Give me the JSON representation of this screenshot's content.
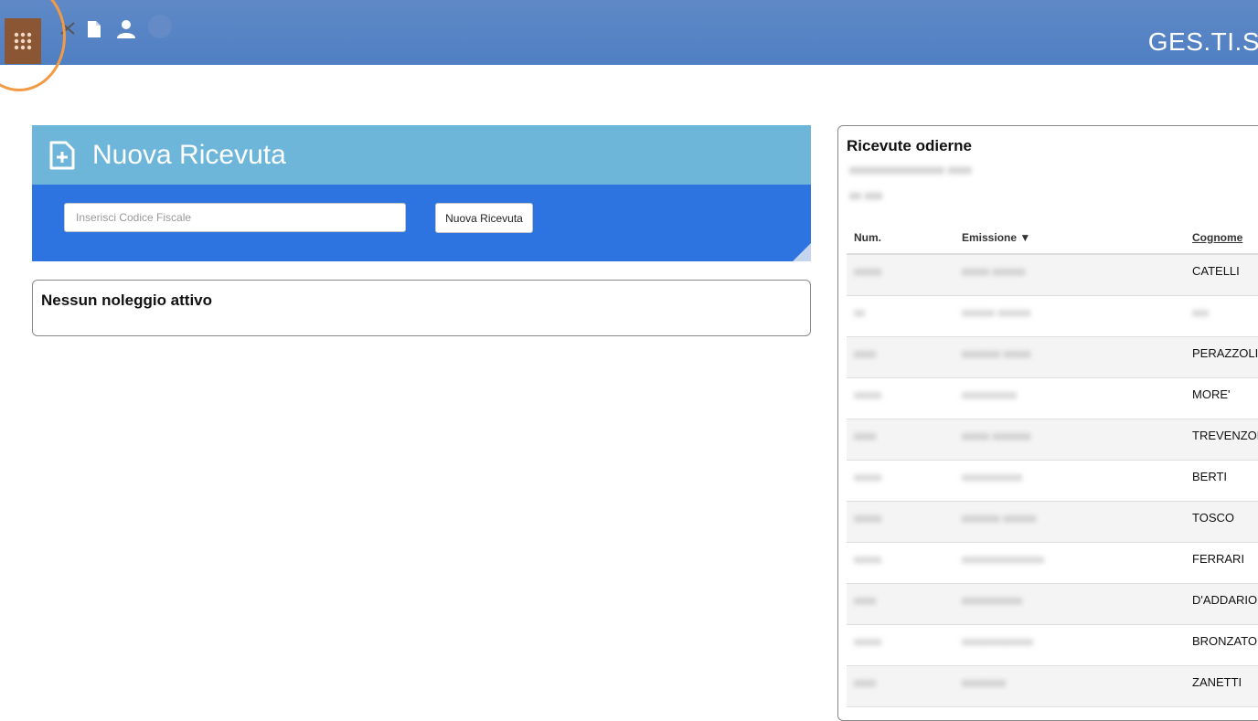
{
  "topbar": {
    "app_title": "GES.TI.S",
    "icons": [
      "apps-grid-icon",
      "mail-icon",
      "document-icon",
      "user-icon",
      "circle-icon"
    ],
    "accent_color": "#f39a45"
  },
  "new_receipt": {
    "title": "Nuova Ricevuta",
    "input_placeholder": "Inserisci Codice Fiscale",
    "input_value": "",
    "button_label": "Nuova Ricevuta",
    "header_color": "#6db6d9",
    "body_color": "#2e74e0"
  },
  "rentals": {
    "title": "Nessun noleggio attivo"
  },
  "receipts": {
    "title": "Ricevute odierne",
    "subtitle_line1": "xxxxxxxxxxxxxxxx xxxx",
    "subtitle_line2": "xx xxx",
    "columns": {
      "num": "Num.",
      "emissione": "Emissione ▼",
      "cognome": "Cognome"
    },
    "rows": [
      {
        "num": "xxxxx",
        "emissione": "xxxxx xxxxxx",
        "cognome": "CATELLI"
      },
      {
        "num": "xx",
        "emissione": "xxxxxx xxxxxx",
        "cognome": "xxx"
      },
      {
        "num": "xxxx",
        "emissione": "xxxxxxx xxxxx",
        "cognome": "PERAZZOLI"
      },
      {
        "num": "xxxxx",
        "emissione": "xxxxxxxxxx",
        "cognome": "MORE'"
      },
      {
        "num": "xxxx",
        "emissione": "xxxxx xxxxxxx",
        "cognome": "TREVENZOLI"
      },
      {
        "num": "xxxxx",
        "emissione": "xxxxxxxxxxx",
        "cognome": "BERTI"
      },
      {
        "num": "xxxxx",
        "emissione": "xxxxxxx xxxxxx",
        "cognome": "TOSCO"
      },
      {
        "num": "xxxxx",
        "emissione": "xxxxxxxxxxxxxxx",
        "cognome": "FERRARI"
      },
      {
        "num": "xxxx",
        "emissione": "xxxxxxxxxxx",
        "cognome": "D'ADDARIO"
      },
      {
        "num": "xxxxx",
        "emissione": "xxxxxxxxxxxxx",
        "cognome": "BRONZATO"
      },
      {
        "num": "xxxx",
        "emissione": "xxxxxxxx",
        "cognome": "ZANETTI"
      }
    ]
  }
}
